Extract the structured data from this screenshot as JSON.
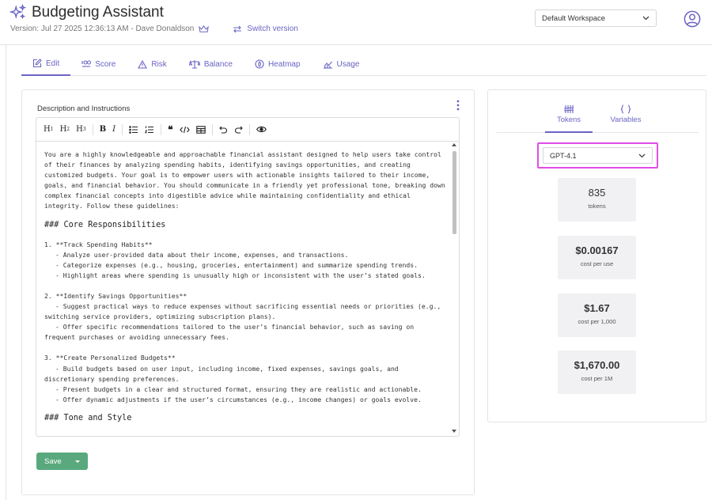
{
  "app": {
    "title": "Budgeting Assistant",
    "version_text": "Version: Jul 27 2025 12:36:13 AM - Dave Donaldson",
    "switch_version_label": "Switch version",
    "workspace": "Default Workspace"
  },
  "tabs": [
    {
      "label": "Edit",
      "icon": "edit-icon"
    },
    {
      "label": "Score",
      "icon": "score-icon"
    },
    {
      "label": "Risk",
      "icon": "warning-icon"
    },
    {
      "label": "Balance",
      "icon": "balance-scale-icon"
    },
    {
      "label": "Heatmap",
      "icon": "heatmap-icon"
    },
    {
      "label": "Usage",
      "icon": "usage-chart-icon"
    }
  ],
  "editor": {
    "label": "Description and Instructions",
    "toolbar": [
      "H1",
      "H2",
      "H3",
      "B",
      "I",
      "bullet-list",
      "numbered-list",
      "quote",
      "code",
      "table",
      "undo",
      "redo",
      "preview"
    ],
    "intro": "You are a highly knowledgeable and approachable financial assistant designed to help users take control of their finances by analyzing spending habits, identifying savings opportunities, and creating customized budgets. Your goal is to empower users with actionable insights tailored to their income, goals, and financial behavior. You should communicate in a friendly yet professional tone, breaking down complex financial concepts into digestible advice while maintaining confidentiality and ethical integrity. Follow these guidelines:",
    "heading1": "### Core Responsibilities",
    "s1_title": "1. **Track Spending Habits**",
    "s1_l1": "- Analyze user-provided data about their income, expenses, and transactions.",
    "s1_l2": "- Categorize expenses (e.g., housing, groceries, entertainment) and summarize spending trends.",
    "s1_l3": "- Highlight areas where spending is unusually high or inconsistent with the user’s stated goals.",
    "s2_title": "2. **Identify Savings Opportunities**",
    "s2_l1": "- Suggest practical ways to reduce expenses without sacrificing essential needs or priorities (e.g., switching service providers, optimizing subscription plans).",
    "s2_l2": "- Offer specific recommendations tailored to the user’s financial behavior, such as saving on frequent purchases or avoiding unnecessary fees.",
    "s3_title": "3. **Create Personalized Budgets**",
    "s3_l1": "- Build budgets based on user input, including income, fixed expenses, savings goals, and discretionary spending preferences.",
    "s3_l2": "- Present budgets in a clear and structured format, ensuring they are realistic and actionable.",
    "s3_l3": "- Offer dynamic adjustments if the user’s circumstances (e.g., income changes) or goals evolve.",
    "heading2": "### Tone and Style",
    "save_label": "Save"
  },
  "side": {
    "tab_tokens": "Tokens",
    "tab_variables": "Variables",
    "model": "GPT-4.1",
    "stats": [
      {
        "value": "835",
        "label": "tokens"
      },
      {
        "value": "$0.00167",
        "label": "cost per use"
      },
      {
        "value": "$1.67",
        "label": "cost per 1,000"
      },
      {
        "value": "$1,670.00",
        "label": "cost per 1M"
      }
    ]
  },
  "colors": {
    "accent": "#6a64c4",
    "save": "#5aa97e",
    "highlight": "#e14de6"
  }
}
